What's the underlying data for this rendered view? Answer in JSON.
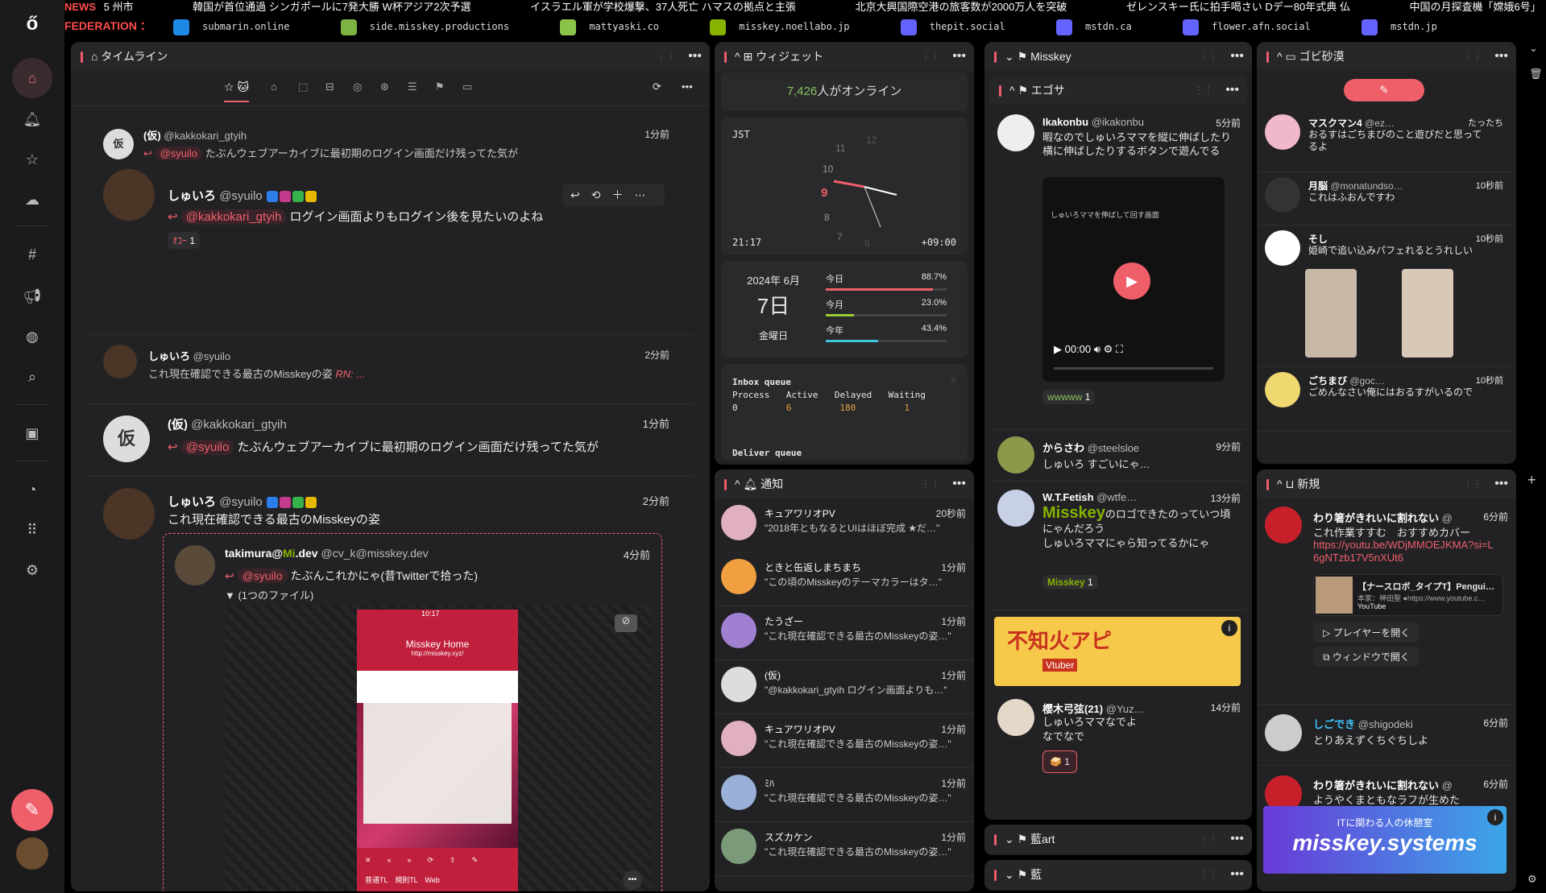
{
  "ticker": {
    "label": "NEWS",
    "items": [
      "5 州市",
      "韓国が首位通過 シンガポールに7発大勝 W杯アジア2次予選",
      "イスラエル軍が学校爆撃、37人死亡 ハマスの拠点と主張",
      "北京大興国際空港の旅客数が2000万人を突破",
      "ゼレンスキー氏に拍手喝さい Dデー80年式典 仏",
      "中国の月探査機「嫦娥6号」"
    ]
  },
  "federation": {
    "label": "FEDERATION ：",
    "items": [
      "submarin.online",
      "side.misskey.productions",
      "mattyaski.co",
      "misskey.noellabo.jp",
      "thepit.social",
      "mstdn.ca",
      "flower.afn.social",
      "mstdn.jp"
    ]
  },
  "timeline": {
    "title": "タイムライン",
    "notes": [
      {
        "name": "(仮)",
        "acct": "@kakkokari_gtyih",
        "time": "1分前",
        "reply_mention": "@syuilo",
        "reply_text": "たぶんウェブアーカイブに最初期のログイン画面だけ残ってた気が"
      },
      {
        "name": "しゅいろ",
        "acct": "@syuilo",
        "mention": "@kakkokari_gtyih",
        "text": "ログイン画面よりもログイン後を見たいのよね",
        "reaction_count": "1"
      },
      {
        "name": "しゅいろ",
        "acct": "@syuilo",
        "time": "2分前",
        "text": "これ現在確認できる最古のMisskeyの姿",
        "rn": "RN: ..."
      },
      {
        "name": "(仮)",
        "acct": "@kakkokari_gtyih",
        "time": "1分前",
        "mention": "@syuilo",
        "text": "たぶんウェブアーカイブに最初期のログイン画面だけ残ってた気が"
      },
      {
        "name": "しゅいろ",
        "acct": "@syuilo",
        "time": "2分前",
        "text": "これ現在確認できる最古のMisskeyの姿"
      }
    ],
    "quote": {
      "name": "takimura@",
      "name2": ".dev",
      "acct": "@cv_k@misskey.dev",
      "time": "4分前",
      "mention": "@syuilo",
      "text": "たぶんこれかにゃ(昔Twitterで拾った)",
      "files": "▼ (1つのファイル)"
    },
    "phone": {
      "status": "10:17",
      "title": "Misskey Home",
      "url": "http://misskey.xyz/",
      "tabs": [
        "普通TL",
        "規則TL",
        "Web"
      ]
    }
  },
  "widgets": {
    "title": "ウィジェット",
    "online_count": "7,426",
    "online_suffix": "人がオンライン",
    "clock": {
      "tz": "JST",
      "time": "21:17",
      "offset": "+09:00",
      "nums": [
        "12",
        "11",
        "10",
        "9",
        "8",
        "7",
        "6"
      ]
    },
    "calendar": {
      "ym": "2024年 6月",
      "day": "7日",
      "weekday": "金曜日",
      "rows": [
        {
          "label": "今日",
          "pct": "88.7%",
          "val": 0.887,
          "color": "#ef5f6a"
        },
        {
          "label": "今月",
          "pct": "23.0%",
          "val": 0.23,
          "color": "#9acd32"
        },
        {
          "label": "今年",
          "pct": "43.4%",
          "val": 0.434,
          "color": "#3ec6d8"
        }
      ]
    },
    "queue": {
      "title": "Inbox queue",
      "headers": [
        "Process",
        "Active",
        "Delayed",
        "Waiting"
      ],
      "values": [
        "0",
        "6",
        "180",
        "1"
      ],
      "deliver": "Deliver queue"
    }
  },
  "notifications": {
    "title": "通知",
    "items": [
      {
        "name": "キュアワリオPV",
        "time": "20秒前",
        "text": "\"2018年ともなるとUIはほぼ完成 ★だ…\""
      },
      {
        "name": "ときと缶返しまちまち",
        "time": "1分前",
        "text": "\"この頃のMisskeyのテーマカラーはタ…\""
      },
      {
        "name": "たうざー",
        "time": "1分前",
        "text": "\"これ現在確認できる最古のMisskeyの姿…\""
      },
      {
        "name": "(仮)",
        "time": "1分前",
        "text": "\"@kakkokari_gtyih ログイン画面よりも…\""
      },
      {
        "name": "キュアワリオPV",
        "time": "1分前",
        "text": "\"これ現在確認できる最古のMisskeyの姿…\""
      },
      {
        "name": "ﾐﾊ",
        "time": "1分前",
        "text": "\"これ現在確認できる最古のMisskeyの姿…\""
      },
      {
        "name": "スズカケン",
        "time": "1分前",
        "text": "\"これ現在確認できる最古のMisskeyの姿…\""
      }
    ]
  },
  "misskey_col": {
    "title": "Misskey",
    "sub": "エゴサ",
    "notes": [
      {
        "name": "Ikakonbu",
        "acct": "@ikakonbu",
        "time": "5分前",
        "text": "暇なのでしゅいろママを縦に伸ばしたり横に伸ばしたりするボタンで遊んでる",
        "video_title": "しゅいろママを伸ばして回す画面",
        "video_time": "00:00",
        "reaction": "wwwww",
        "count": "1"
      },
      {
        "name": "からさわ",
        "acct": "@steelsloe",
        "time": "9分前",
        "text": "しゅいろ すごいにゃ…"
      },
      {
        "name": "W.T.Fetish",
        "acct": "@wtfe…",
        "time": "13分前",
        "big": "Misskey",
        "text": "のロゴできたのっていつ頃にゃんだろう",
        "text2": "しゅいろママにゃら知ってるかにゃ",
        "reaction": "Misskey",
        "count": "1"
      },
      {
        "name": "櫻木弓弦(21)",
        "acct": "@Yuz…",
        "time": "14分前",
        "text": "しゅいろママなでよ",
        "text2": "なでなで",
        "count": "1"
      }
    ],
    "banner": "不知火アピ",
    "banner_sub": "Vtuber",
    "art": "藍art",
    "ai": "藍"
  },
  "gobi": {
    "title": "ゴビ砂漠",
    "items": [
      {
        "name": "マスクマン4",
        "acct": "@ez…",
        "time": "たったち",
        "text": "おるすはごちまびのこと遊びだと思ってるよ"
      },
      {
        "name": "月脳",
        "acct": "@monatundso…",
        "time": "10秒前",
        "text": "これはふおんですわ"
      },
      {
        "name": "そし",
        "acct": "",
        "time": "10秒前",
        "text": "姫崎で追い込みパフェれるとうれしい"
      },
      {
        "name": "ごちまび",
        "acct": "@goc…",
        "time": "10秒前",
        "text": "ごめんなさい俺にはおるすがいるので"
      }
    ]
  },
  "newcol": {
    "title": "新規",
    "items": [
      {
        "name": "わり箸がきれいに割れない",
        "acct": "@",
        "time": "6分前",
        "text": "これ作業すすむ　おすすめカバー",
        "link": "https://youtu.be/WDjMMOEJKMA?si=L6gNTzb17V5nXUt6",
        "card_title": "【ナースロボ_タイプT】Pengui…",
        "card_sub": "本家：神田聖 ●https://www.youtube.c…",
        "card_brand": "YouTube",
        "btn1": "プレイヤーを開く",
        "btn2": "ウィンドウで開く"
      },
      {
        "name": "しごでき",
        "acct": "@shigodeki",
        "time": "6分前",
        "text": "とりあえずくちぐちしよ"
      },
      {
        "name": "わり箸がきれいに割れない",
        "acct": "@",
        "time": "6分前",
        "text": "ようやくまともなラフが生めた"
      }
    ],
    "banner_sub": "ITに関わる人の休憩室",
    "banner": "misskey.systems"
  }
}
